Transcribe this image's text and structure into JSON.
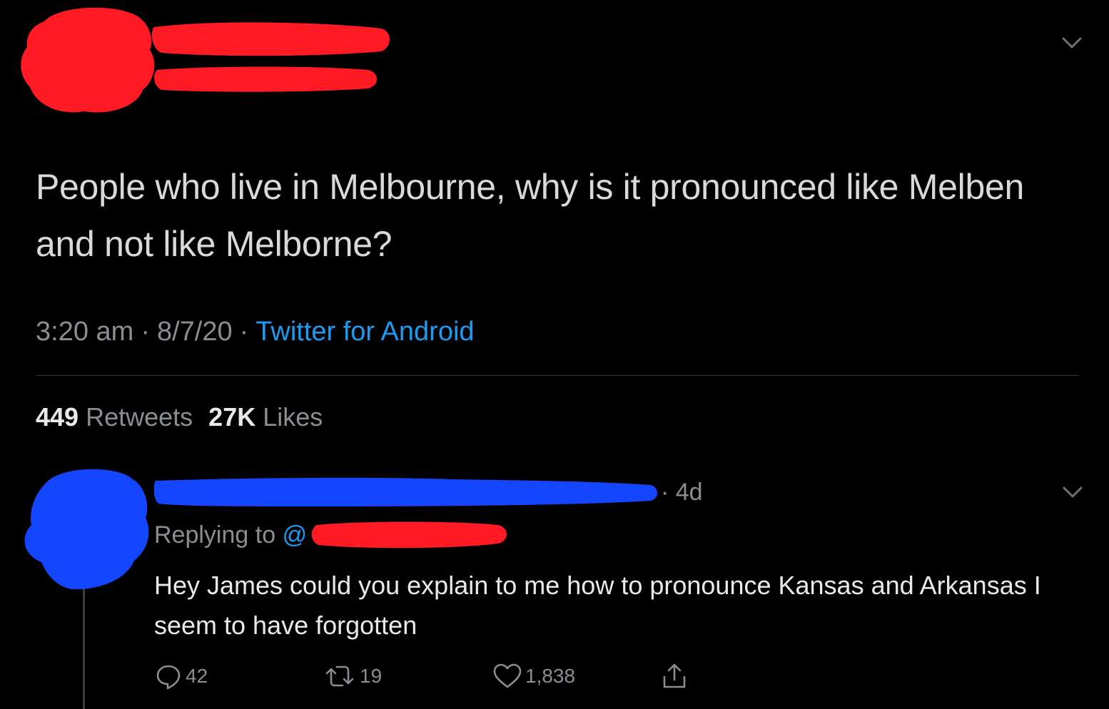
{
  "tweet": {
    "text": "People who live in Melbourne, why is it pronounced like Melben and not like Melborne?",
    "time": "3:20 am",
    "separator": "·",
    "date": "8/7/20",
    "source": "Twitter for Android",
    "retweets_count": "449",
    "retweets_label": "Retweets",
    "likes_count": "27K",
    "likes_label": "Likes",
    "menu_icon": "chevron-down-icon"
  },
  "reply": {
    "time_ago": "· 4d",
    "replying_to_label": "Replying to",
    "replying_to_handle_prefix": "@",
    "text": "Hey James could you explain to me how to pronounce Kansas and Arkansas I seem to have forgotten",
    "reply_count": "42",
    "retweet_count": "19",
    "like_count": "1,838",
    "menu_icon": "chevron-down-icon"
  },
  "colors": {
    "background": "#000000",
    "text_primary": "#e7e9ea",
    "text_secondary": "#8a8d91",
    "link": "#1d9bf0",
    "redaction_red": "#ff1a24",
    "redaction_blue": "#1446ff"
  }
}
